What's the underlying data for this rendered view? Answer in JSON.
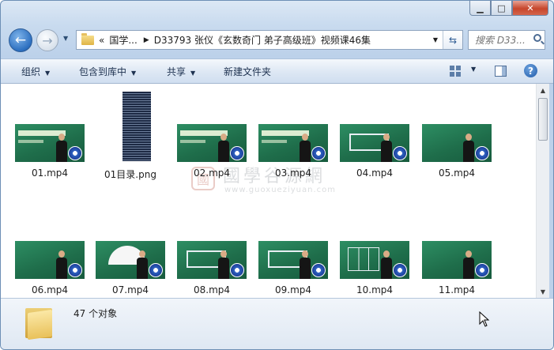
{
  "window": {
    "caption_buttons": {
      "minimize": "▁",
      "maximize": "□",
      "close": "✕"
    }
  },
  "navbar": {
    "back_glyph": "←",
    "forward_glyph": "→",
    "dropdown_glyph": "▼",
    "breadcrumb": {
      "overflow": "«",
      "parent": "国学...",
      "separator": "▶",
      "current": "D33793 张仪《玄数奇门 弟子高级班》视频课46集"
    },
    "address_dropdown_glyph": "▼",
    "refresh_glyph": "⇆",
    "search_placeholder": "搜索 D33..."
  },
  "toolbar": {
    "organize": "组织",
    "include_in_library": "包含到库中",
    "share": "共享",
    "new_folder": "新建文件夹",
    "arrow": "▼",
    "help": "?"
  },
  "files": [
    {
      "name": "01.mp4",
      "type": "video",
      "style": "banner"
    },
    {
      "name": "01目录.png",
      "type": "image",
      "style": "png"
    },
    {
      "name": "02.mp4",
      "type": "video",
      "style": "banner"
    },
    {
      "name": "03.mp4",
      "type": "video",
      "style": "banner"
    },
    {
      "name": "04.mp4",
      "type": "video",
      "style": "board"
    },
    {
      "name": "05.mp4",
      "type": "video",
      "style": "plain"
    },
    {
      "name": "06.mp4",
      "type": "video",
      "style": "plain"
    },
    {
      "name": "07.mp4",
      "type": "video",
      "style": "fan"
    },
    {
      "name": "08.mp4",
      "type": "video",
      "style": "board"
    },
    {
      "name": "09.mp4",
      "type": "video",
      "style": "board"
    },
    {
      "name": "10.mp4",
      "type": "video",
      "style": "grid"
    },
    {
      "name": "11.mp4",
      "type": "video",
      "style": "plain"
    }
  ],
  "watermark": {
    "logo": "國",
    "text": "國學谷源網",
    "url": "www.guoxueziyuan.com"
  },
  "scrollbar": {
    "up": "▲",
    "down": "▼"
  },
  "status": {
    "item_count": "47 个对象"
  }
}
